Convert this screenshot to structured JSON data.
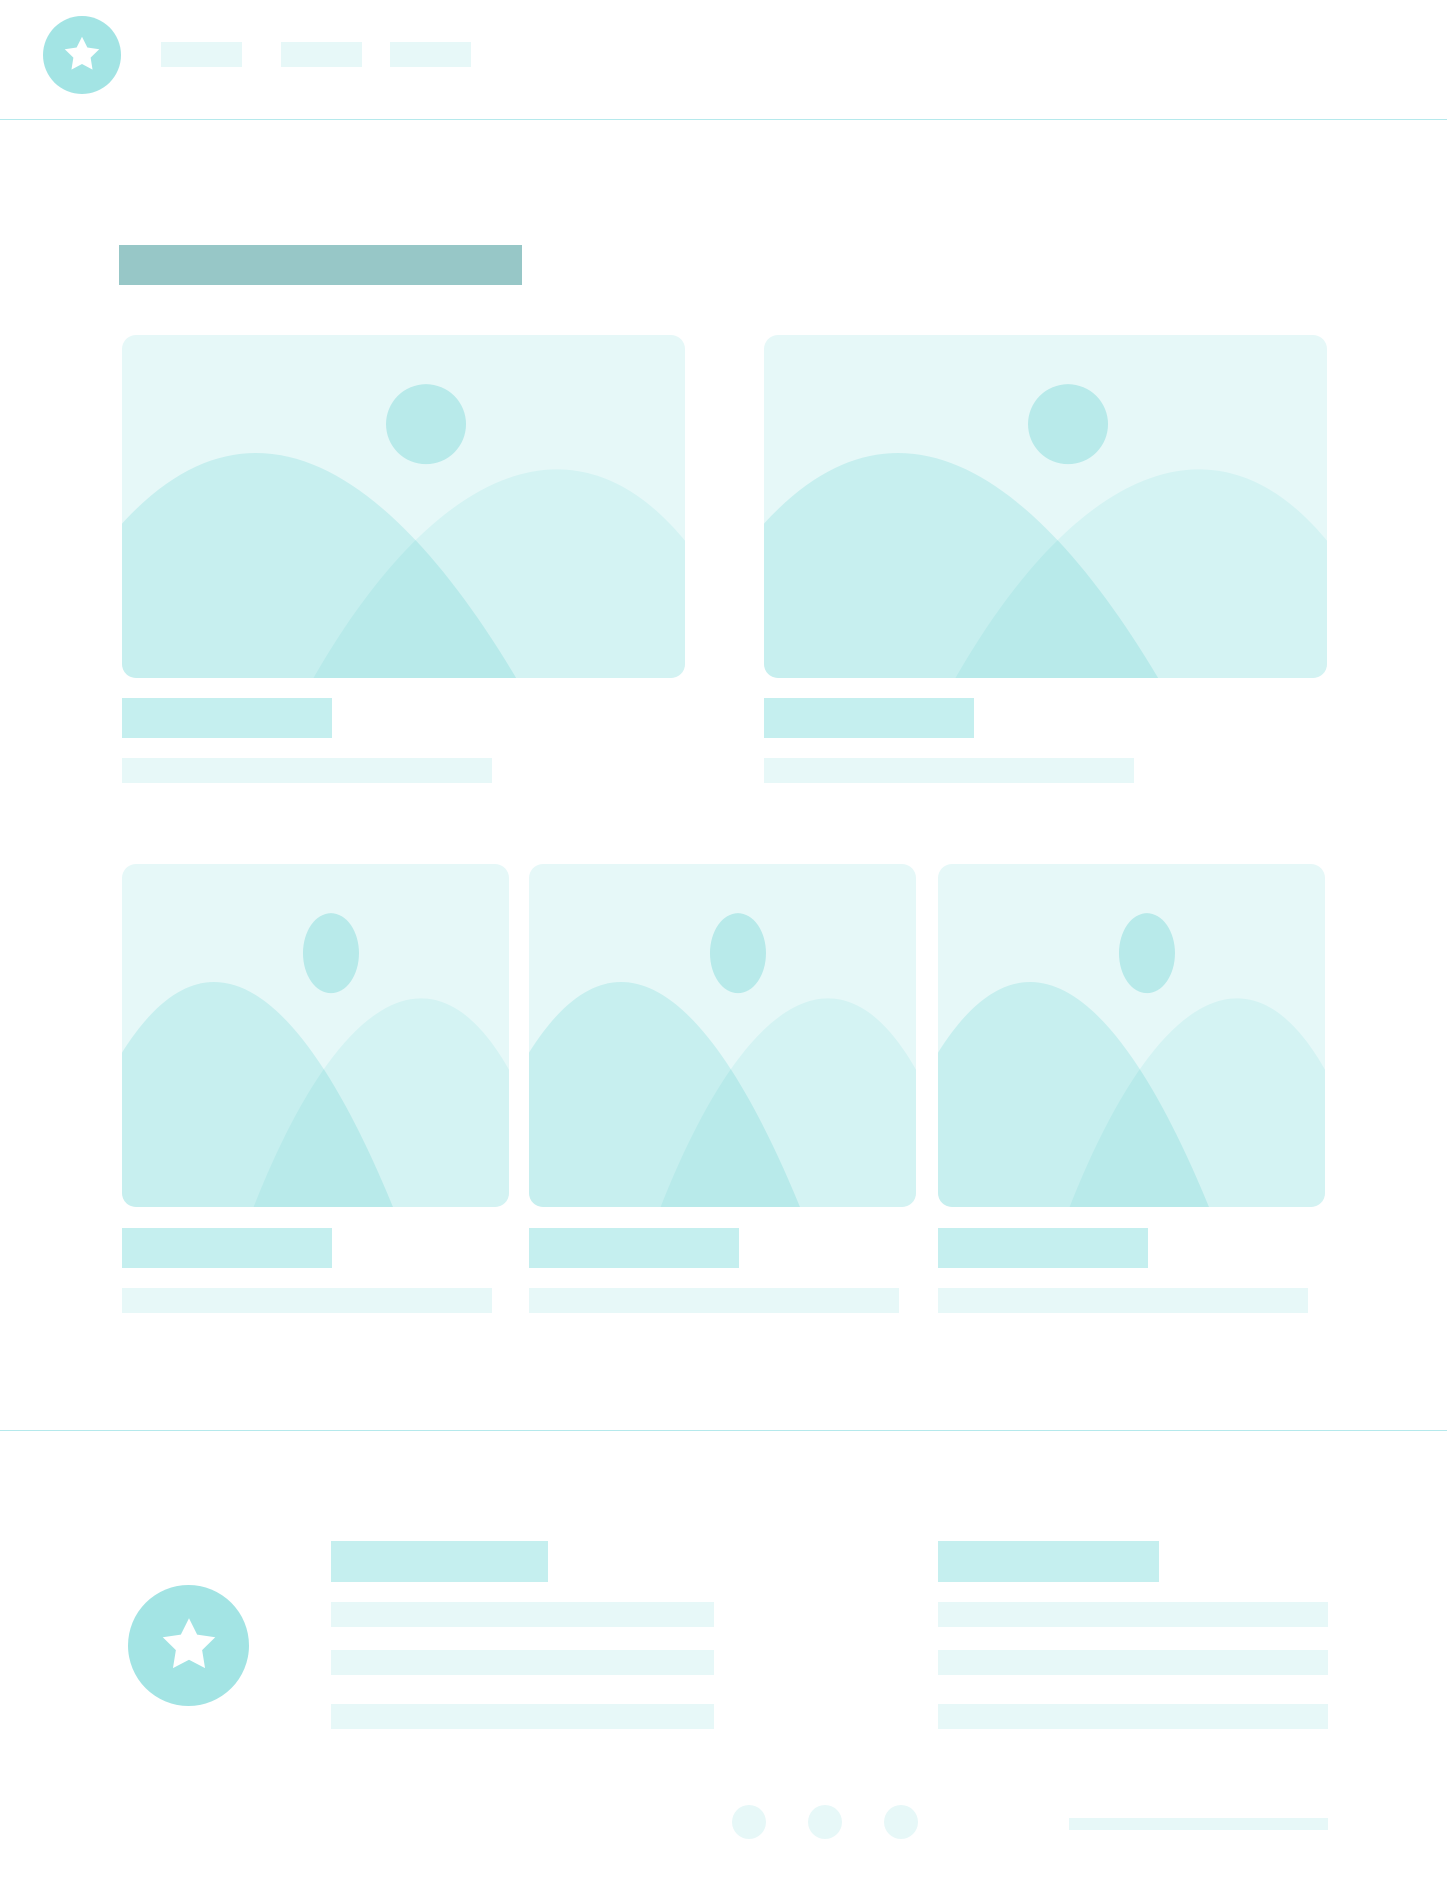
{
  "colors": {
    "logo": "#a3e4e4",
    "pale": "#e7f8f8",
    "mid": "#c5efef",
    "heading": "#97c7c7",
    "line": "#b5e9ec",
    "image_bg": "#e6f8f8",
    "hill_back": "#d4f3f3",
    "hill_front": "#c7efef",
    "hill_overlap": "#b8eaea",
    "sun": "#b8eaea"
  },
  "icons": {
    "header_logo": "star-icon",
    "footer_logo": "star-icon",
    "image_placeholder": "image-placeholder-icon"
  },
  "nav": {
    "item_count": 3
  },
  "cards": {
    "row1_count": 2,
    "row2_count": 3
  },
  "footer": {
    "link_columns": 2,
    "social_dots": 3
  }
}
